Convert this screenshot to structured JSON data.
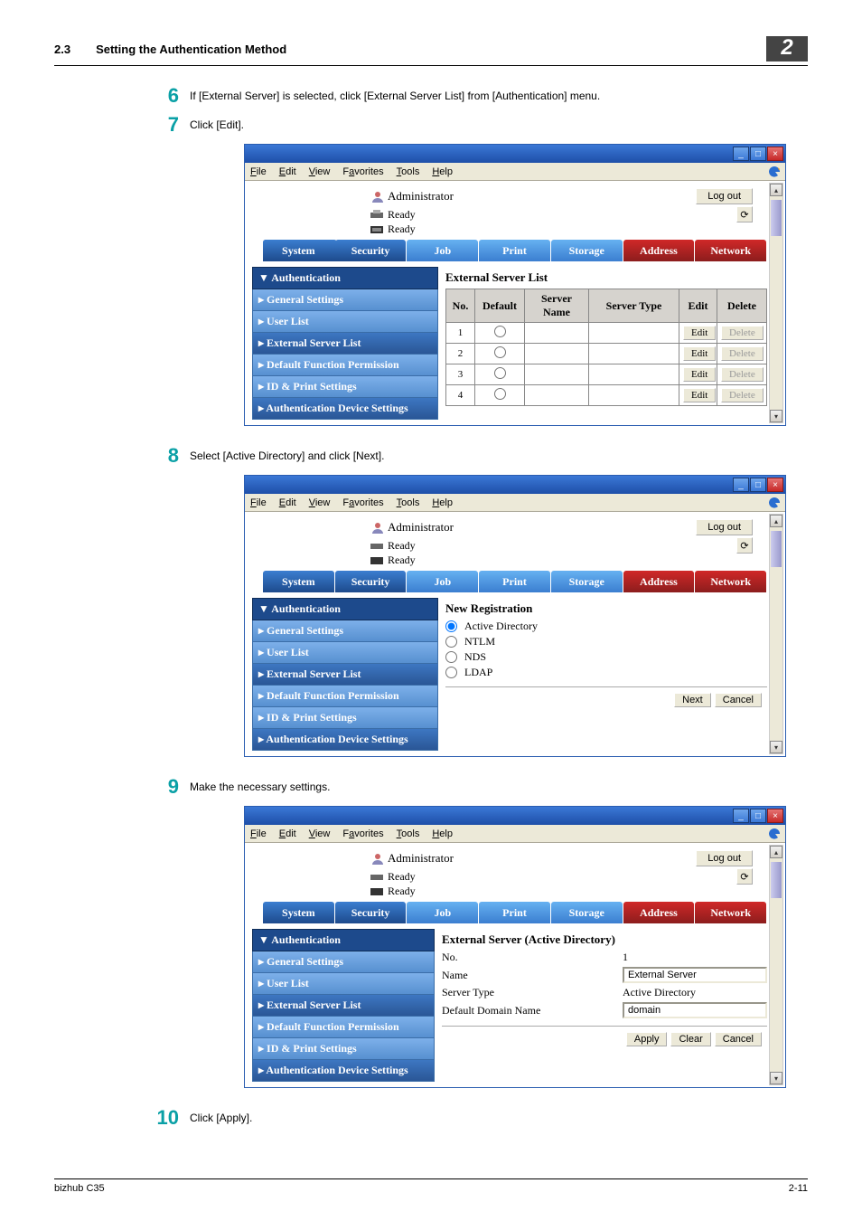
{
  "header": {
    "section_num": "2.3",
    "section_title": "Setting the Authentication Method",
    "chapter": "2"
  },
  "steps": {
    "s6": {
      "n": "6",
      "t": "If [External Server] is selected, click [External Server List] from [Authentication] menu."
    },
    "s7": {
      "n": "7",
      "t": "Click [Edit]."
    },
    "s8": {
      "n": "8",
      "t": "Select [Active Directory] and click [Next]."
    },
    "s9": {
      "n": "9",
      "t": "Make the necessary settings."
    },
    "s10": {
      "n": "10",
      "t": "Click [Apply]."
    }
  },
  "menubar": {
    "file": "File",
    "edit": "Edit",
    "view": "View",
    "favorites": "Favorites",
    "tools": "Tools",
    "help": "Help"
  },
  "admin": {
    "label": "Administrator",
    "logout": "Log out",
    "ready": "Ready"
  },
  "tabs": {
    "system": "System",
    "security": "Security",
    "job": "Job",
    "print": "Print",
    "storage": "Storage",
    "address": "Address",
    "network": "Network"
  },
  "sidebar": {
    "auth": "Authentication",
    "items": [
      {
        "label": "General Settings"
      },
      {
        "label": "User List"
      },
      {
        "label": "External Server List"
      },
      {
        "label": "Default Function Permission"
      },
      {
        "label": "ID & Print Settings"
      },
      {
        "label": "Authentication Device Settings"
      }
    ]
  },
  "shot1": {
    "title": "External Server List",
    "thead": {
      "no": "No.",
      "default": "Default",
      "server_name": "Server Name",
      "server_type": "Server Type",
      "edit": "Edit",
      "delete": "Delete"
    },
    "rows": [
      {
        "no": "1"
      },
      {
        "no": "2"
      },
      {
        "no": "3"
      },
      {
        "no": "4"
      }
    ],
    "edit_btn": "Edit",
    "delete_btn": "Delete"
  },
  "shot2": {
    "title": "New Registration",
    "opts": {
      "ad": "Active Directory",
      "ntlm": "NTLM",
      "nds": "NDS",
      "ldap": "LDAP"
    },
    "next": "Next",
    "cancel": "Cancel"
  },
  "shot3": {
    "title": "External Server (Active Directory)",
    "rows": {
      "no": {
        "l": "No.",
        "v": "1"
      },
      "name": {
        "l": "Name",
        "v": "External Server"
      },
      "type": {
        "l": "Server Type",
        "v": "Active Directory"
      },
      "domain": {
        "l": "Default Domain Name",
        "v": "domain"
      }
    },
    "apply": "Apply",
    "clear": "Clear",
    "cancel": "Cancel"
  },
  "footer": {
    "left": "bizhub C35",
    "right": "2-11"
  }
}
